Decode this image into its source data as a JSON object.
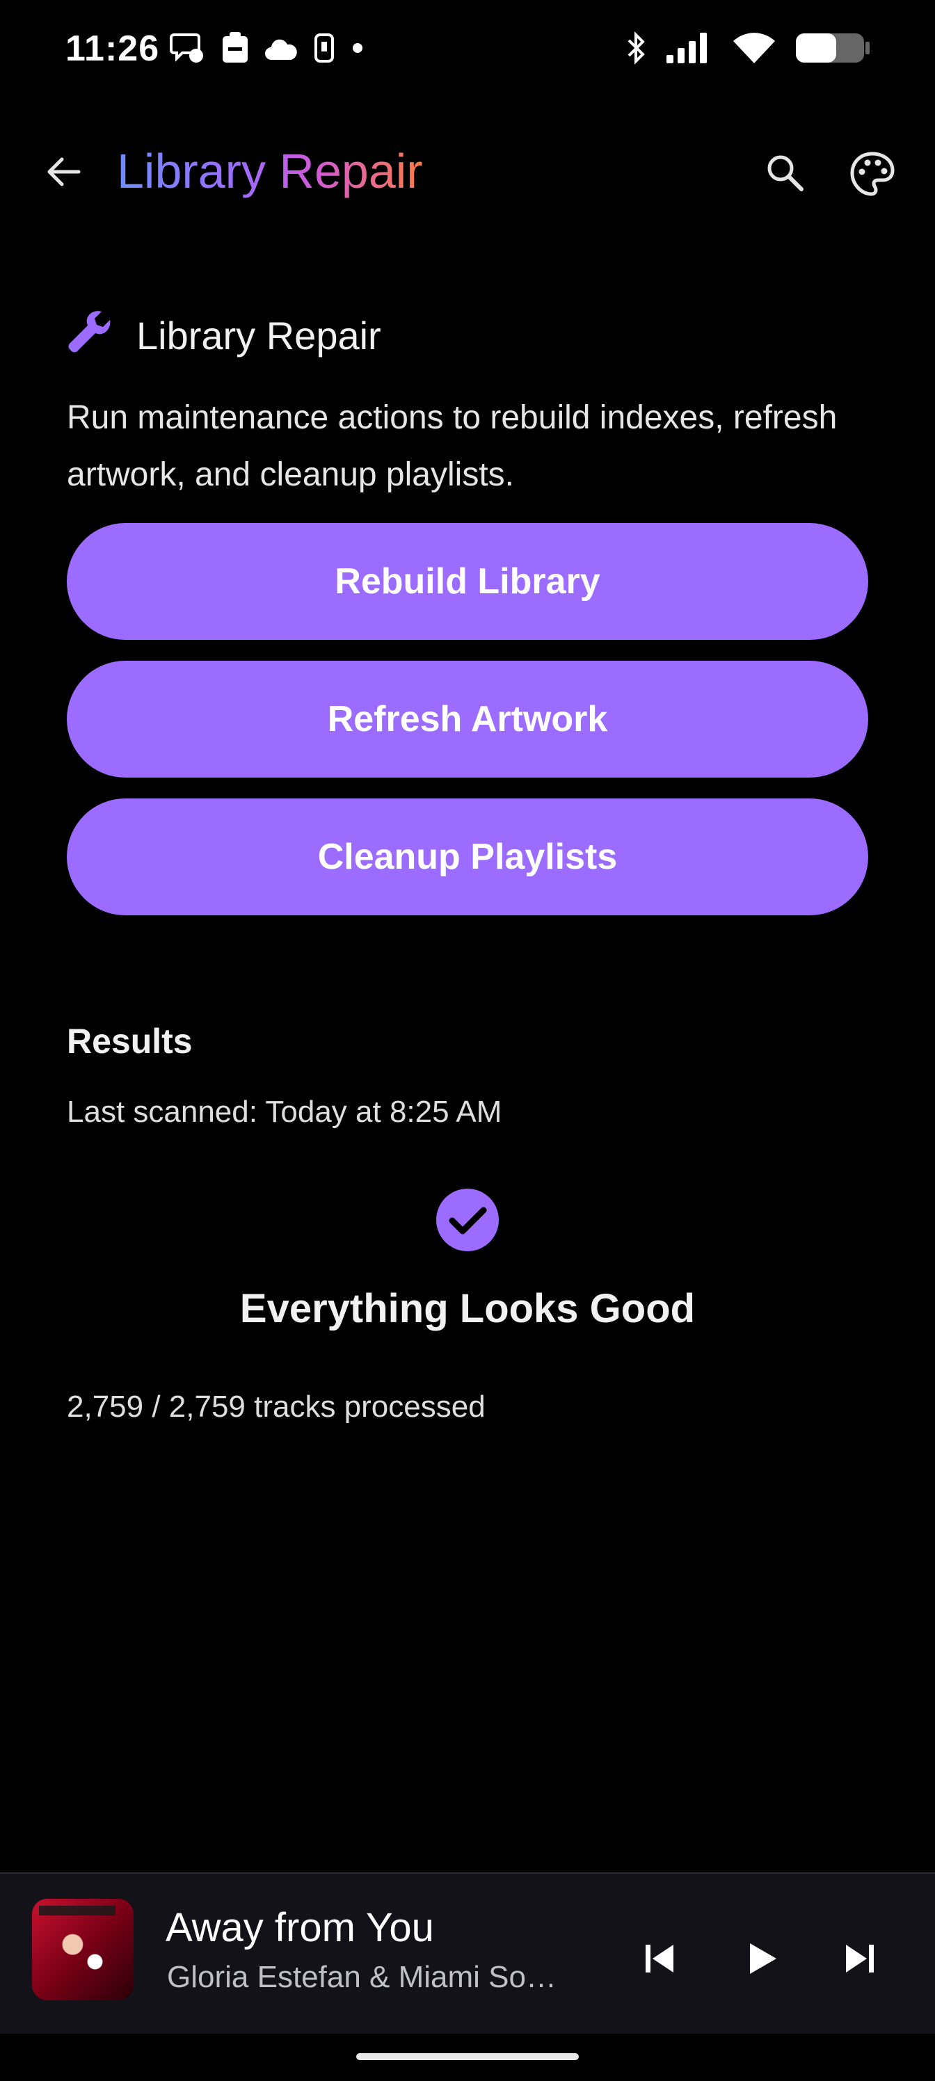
{
  "status_bar": {
    "time": "11:26",
    "icons_left": [
      "messenger-icon",
      "clipboard-icon",
      "weather-icon",
      "notification-icon",
      "dot-icon"
    ],
    "icons_right": [
      "bluetooth-icon",
      "signal-icon",
      "wifi-icon",
      "battery-icon"
    ]
  },
  "app_bar": {
    "title": "Library Repair",
    "back_icon": "arrow-left-icon",
    "search_icon": "search-icon",
    "palette_icon": "palette-icon"
  },
  "section": {
    "icon": "wrench-icon",
    "title": "Library Repair",
    "description": "Run maintenance actions to rebuild indexes, refresh artwork, and cleanup playlists."
  },
  "actions": {
    "rebuild_label": "Rebuild Library",
    "refresh_label": "Refresh Artwork",
    "cleanup_label": "Cleanup Playlists"
  },
  "results": {
    "title": "Results",
    "last_scanned": "Last scanned: Today at 8:25 AM",
    "status_title": "Everything Looks Good",
    "tracks_processed": "2,759 / 2,759 tracks processed"
  },
  "mini_player": {
    "song_title": "Away from You",
    "artist": "Gloria Estefan & Miami So…"
  },
  "colors": {
    "accent": "#9c6bff",
    "background": "#000000",
    "player_background": "#121218"
  }
}
